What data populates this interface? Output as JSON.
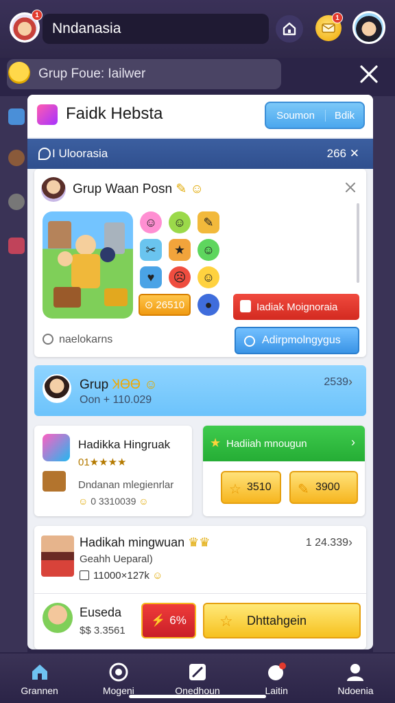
{
  "topbar": {
    "username": "Nndanasia",
    "profile_badge": "1",
    "mail_badge": "1"
  },
  "group": {
    "name": "Grup Foue: Iailwer"
  },
  "card": {
    "title": "Faidk Hebsta",
    "btn_left": "Soumon",
    "btn_right": "Bdik",
    "strip_label": "I Uloorasia",
    "strip_count": "266"
  },
  "panel": {
    "title": "Grup Waan Posn",
    "score": "26510",
    "red_btn": "Iadiak Moignoraia",
    "blue_btn": "Adirpmolngygus",
    "hint": "naelokarns"
  },
  "group_banner": {
    "title": "Grup",
    "title_accent": "ꞰᎾᎾ",
    "subtitle": "Oon + 110.029",
    "count": "2539"
  },
  "left_card": {
    "title": "Hadikka Hingruak",
    "stars": "01★★★★",
    "desc": "Dndanan mlegienrlar",
    "code": "0 3310039"
  },
  "right_card": {
    "title": "Hadiiah mnougun",
    "pill1": "3510",
    "pill2": "3900"
  },
  "weekly": {
    "title": "Hadikah mingwuan",
    "subtitle": "Geahh Ueparal)",
    "code": "11000×127k",
    "count": "1 24.339",
    "bd_title": "Euseda",
    "bd_sub": "$$ 3.3561",
    "pct": "6%",
    "claim": "Dhttahgein"
  },
  "nav": [
    {
      "label": "Grannen",
      "icon": "home-icon"
    },
    {
      "label": "Mogeni",
      "icon": "gear-icon"
    },
    {
      "label": "Onedhoun",
      "icon": "pen-icon"
    },
    {
      "label": "Laitin",
      "icon": "bubble-icon"
    },
    {
      "label": "Ndoenia",
      "icon": "user-icon"
    }
  ],
  "colors": {
    "background": "#2b2447",
    "accent_blue": "#4aa7ee",
    "accent_green": "#25ad35",
    "accent_red": "#d32a20",
    "accent_yellow": "#f6c11f"
  }
}
